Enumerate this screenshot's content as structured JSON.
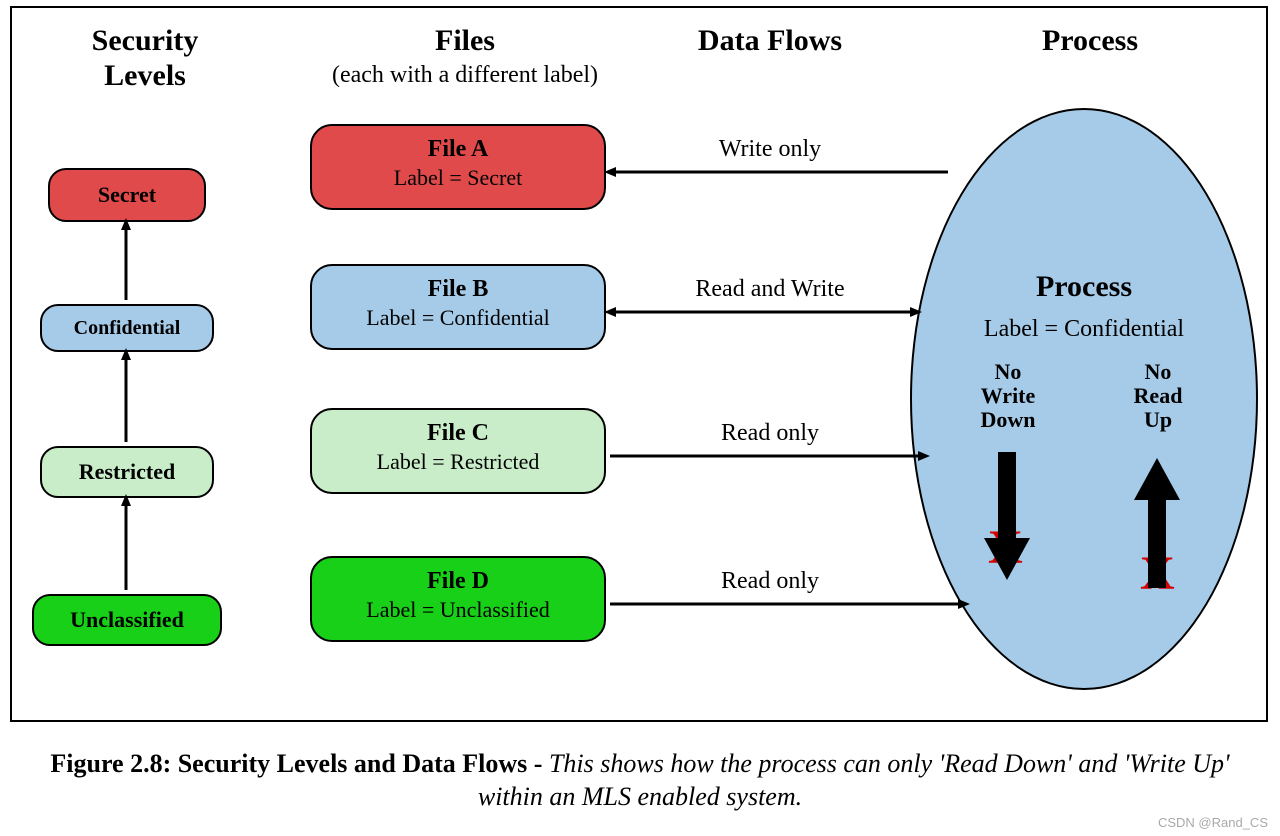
{
  "headers": {
    "security_levels": "Security\nLevels",
    "files": "Files",
    "files_sub": "(each with a different label)",
    "data_flows": "Data Flows",
    "process": "Process"
  },
  "levels": [
    {
      "name": "Secret",
      "color": "#e04a4a"
    },
    {
      "name": "Confidential",
      "color": "#a6cbe8"
    },
    {
      "name": "Restricted",
      "color": "#c8edc8"
    },
    {
      "name": "Unclassified",
      "color": "#18d018"
    }
  ],
  "files": [
    {
      "title": "File A",
      "label": "Label = Secret",
      "color": "#e04a4a"
    },
    {
      "title": "File B",
      "label": "Label = Confidential",
      "color": "#a6cbe8"
    },
    {
      "title": "File C",
      "label": "Label = Restricted",
      "color": "#c8edc8"
    },
    {
      "title": "File D",
      "label": "Label = Unclassified",
      "color": "#18d018"
    }
  ],
  "flows": [
    {
      "label": "Write only",
      "left_arrow": true,
      "right_arrow": false
    },
    {
      "label": "Read and Write",
      "left_arrow": true,
      "right_arrow": true
    },
    {
      "label": "Read only",
      "left_arrow": false,
      "right_arrow": true
    },
    {
      "label": "Read only",
      "left_arrow": false,
      "right_arrow": true
    }
  ],
  "process": {
    "title": "Process",
    "label": "Label = Confidential",
    "rules": {
      "no_write_down": "No\nWrite\nDown",
      "no_read_up": "No\nRead\nUp"
    },
    "x_mark": "X"
  },
  "caption": {
    "lead": "Figure 2.8: Security Levels and Data Flows - ",
    "body": "This shows how the process can only 'Read Down' and 'Write Up' within an MLS enabled system."
  },
  "watermark": "CSDN @Rand_CS"
}
